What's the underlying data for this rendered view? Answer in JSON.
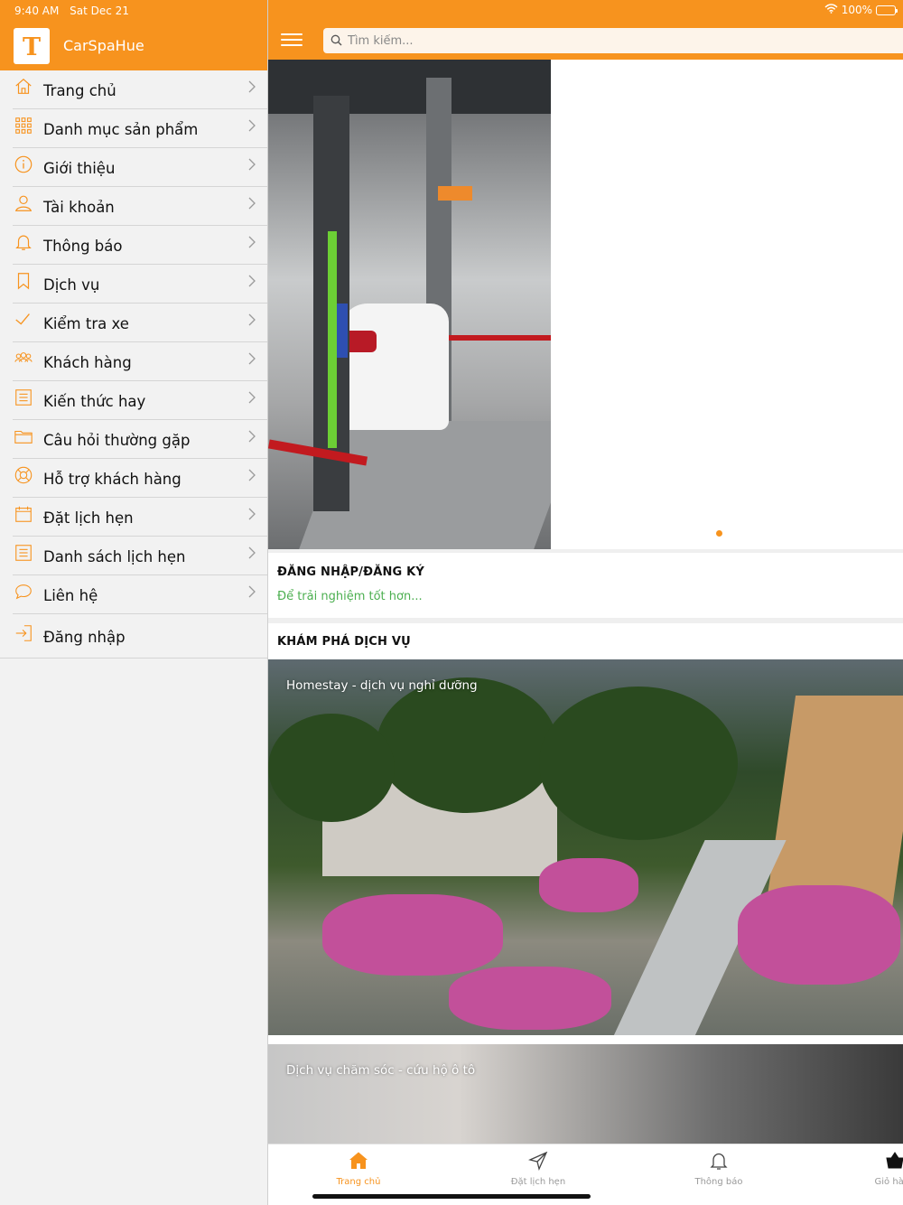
{
  "status": {
    "time": "9:40 AM",
    "date": "Sat Dec 21",
    "battery": "100%"
  },
  "app": {
    "name": "CarSpaHue",
    "logo_letter": "T"
  },
  "sidebar": {
    "items": [
      {
        "label": "Trang chủ",
        "icon": "home-icon"
      },
      {
        "label": "Danh mục sản phẩm",
        "icon": "grid-icon"
      },
      {
        "label": "Giới thiệu",
        "icon": "info-icon"
      },
      {
        "label": "Tài khoản",
        "icon": "user-icon"
      },
      {
        "label": "Thông báo",
        "icon": "bell-icon"
      },
      {
        "label": "Dịch vụ",
        "icon": "bookmark-icon"
      },
      {
        "label": "Kiểm tra xe",
        "icon": "check-icon"
      },
      {
        "label": "Khách hàng",
        "icon": "users-icon"
      },
      {
        "label": "Kiến thức hay",
        "icon": "list-icon"
      },
      {
        "label": "Câu hỏi thường gặp",
        "icon": "folder-icon"
      },
      {
        "label": "Hỗ trợ khách hàng",
        "icon": "lifebuoy-icon"
      },
      {
        "label": "Đặt lịch hẹn",
        "icon": "calendar-icon"
      },
      {
        "label": "Danh sách lịch hẹn",
        "icon": "list-icon"
      },
      {
        "label": "Liên hệ",
        "icon": "chat-icon"
      },
      {
        "label": "Đăng nhập",
        "icon": "login-icon"
      }
    ]
  },
  "search": {
    "placeholder": "Tìm kiếm..."
  },
  "banner": {
    "image": "car-wash-station-photo",
    "dots": 1,
    "active_dot": 1
  },
  "login": {
    "title": "ĐĂNG NHẬP/ĐĂNG KÝ",
    "subtitle": "Để trải nghiệm tốt hơn..."
  },
  "explore": {
    "title": "KHÁM PHÁ DỊCH VỤ"
  },
  "cards": [
    {
      "title": "Homestay - dịch vụ nghỉ dưỡng"
    },
    {
      "title": "Dịch vụ chăm sóc - cứu hộ ô tô"
    }
  ],
  "tabs": [
    {
      "label": "Trang chủ",
      "icon": "home-icon",
      "active": true
    },
    {
      "label": "Đặt lịch hẹn",
      "icon": "send-icon",
      "active": false
    },
    {
      "label": "Thông báo",
      "icon": "bell-icon",
      "active": false
    },
    {
      "label": "Giỏ hàng",
      "icon": "cart-icon",
      "active": false
    }
  ],
  "colors": {
    "brand": "#f7931e",
    "subtitle_green": "#4caf50",
    "sidebar_bg": "#f2f2f2"
  }
}
